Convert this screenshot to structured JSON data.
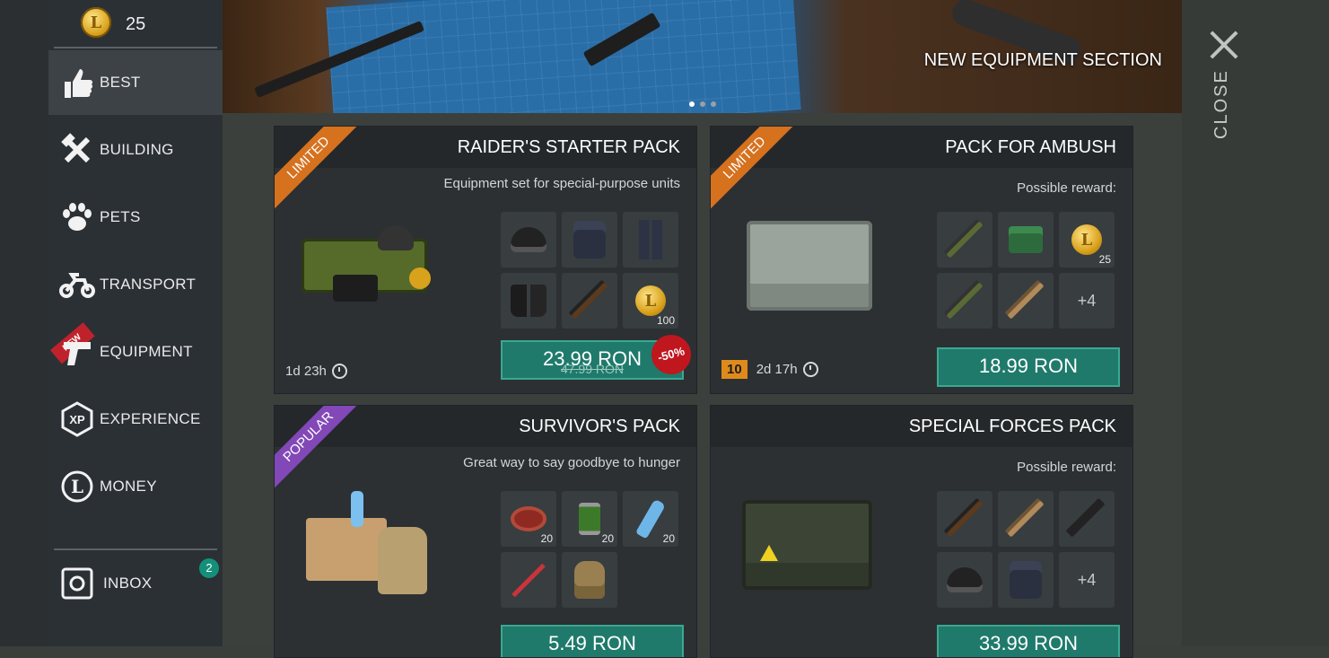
{
  "currency": {
    "icon": "coin-icon",
    "glyph": "L",
    "amount": "25"
  },
  "sidebar": {
    "items": [
      {
        "label": "BEST",
        "icon": "thumbs-up-icon"
      },
      {
        "label": "BUILDING",
        "icon": "hammer-wrench-icon"
      },
      {
        "label": "PETS",
        "icon": "paw-icon"
      },
      {
        "label": "TRANSPORT",
        "icon": "motorcycle-icon"
      },
      {
        "label": "EQUIPMENT",
        "icon": "pistol-icon",
        "badge": "NEW"
      },
      {
        "label": "EXPERIENCE",
        "icon": "xp-icon",
        "glyph": "XP"
      },
      {
        "label": "MONEY",
        "icon": "coin-icon",
        "glyph": "L"
      }
    ],
    "inbox": {
      "label": "INBOX",
      "icon": "safe-icon",
      "count": "2"
    }
  },
  "banner": {
    "title": "NEW EQUIPMENT SECTION"
  },
  "close": {
    "label": "CLOSE"
  },
  "cards": [
    {
      "title": "RAIDER'S STARTER PACK",
      "subtitle": "Equipment set for special-purpose units",
      "ribbon": "LIMITED",
      "timer": "1d 23h",
      "price": "23.99 RON",
      "old_price": "47.99 RON",
      "discount": "-50%",
      "items": [
        {
          "count": ""
        },
        {
          "count": ""
        },
        {
          "count": ""
        },
        {
          "count": ""
        },
        {
          "count": ""
        },
        {
          "count": "100",
          "glyph": "L"
        }
      ]
    },
    {
      "title": "PACK FOR AMBUSH",
      "subtitle": "Possible reward:",
      "ribbon": "LIMITED",
      "level": "10",
      "timer": "2d 17h",
      "price": "18.99 RON",
      "items": [
        {
          "count": ""
        },
        {
          "count": ""
        },
        {
          "count": "25",
          "glyph": "L"
        },
        {
          "count": ""
        },
        {
          "count": ""
        },
        {
          "more": "+4"
        }
      ]
    },
    {
      "title": "SURVIVOR'S PACK",
      "subtitle": "Great way to say goodbye to hunger",
      "ribbon": "POPULAR",
      "price": "5.49 RON",
      "items": [
        {
          "count": "20"
        },
        {
          "count": "20"
        },
        {
          "count": "20"
        },
        {
          "count": ""
        },
        {
          "count": ""
        }
      ]
    },
    {
      "title": "SPECIAL FORCES PACK",
      "subtitle": "Possible reward:",
      "price": "33.99 RON",
      "items": [
        {
          "count": ""
        },
        {
          "count": ""
        },
        {
          "count": ""
        },
        {
          "count": ""
        },
        {
          "count": ""
        },
        {
          "more": "+4"
        }
      ]
    }
  ]
}
